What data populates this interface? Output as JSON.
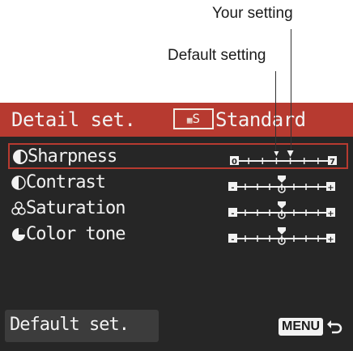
{
  "callouts": {
    "your_setting": "Your setting",
    "default_setting": "Default setting"
  },
  "header": {
    "title": "Detail set.",
    "style_icon": "picture-style-standard-icon",
    "style_icon_text": "S",
    "style_name": "Standard"
  },
  "rows": [
    {
      "label": "Sharpness",
      "icon": "sharpness-icon",
      "scale_min": "0",
      "scale_max": "7",
      "default_value": 3,
      "setting_value": 4,
      "selected": true
    },
    {
      "label": "Contrast",
      "icon": "contrast-icon",
      "scale_min": "-",
      "scale_max": "+",
      "default_value": 0,
      "setting_value": 0,
      "selected": false
    },
    {
      "label": "Saturation",
      "icon": "saturation-icon",
      "scale_min": "-",
      "scale_max": "+",
      "default_value": 0,
      "setting_value": 0,
      "selected": false
    },
    {
      "label": "Color tone",
      "icon": "color-tone-icon",
      "scale_min": "-",
      "scale_max": "+",
      "default_value": 0,
      "setting_value": 0,
      "selected": false
    }
  ],
  "footer": {
    "default_set_label": "Default set.",
    "menu_key": "MENU",
    "return_icon": "return-icon"
  },
  "colors": {
    "accent_red": "#b73a30",
    "screen_bg": "#262626",
    "lcd_text": "#f2f2f2"
  }
}
